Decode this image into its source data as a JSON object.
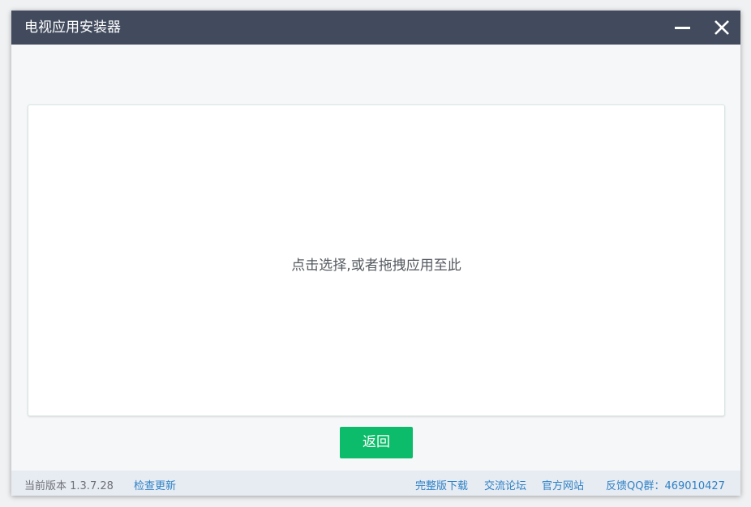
{
  "window": {
    "title": "电视应用安装器"
  },
  "dropzone": {
    "hint": "点击选择,或者拖拽应用至此"
  },
  "actions": {
    "back_label": "返回"
  },
  "statusbar": {
    "version": "当前版本 1.3.7.28",
    "check_update": "检查更新",
    "full_download": "完整版下载",
    "forum": "交流论坛",
    "official_site": "官方网站",
    "qq_group": "反馈QQ群：469010427"
  },
  "colors": {
    "titlebar": "#424b5e",
    "accent_green": "#0dbc6a",
    "link_blue": "#2d82c6"
  },
  "icons": [
    "minimize-icon",
    "close-icon"
  ]
}
